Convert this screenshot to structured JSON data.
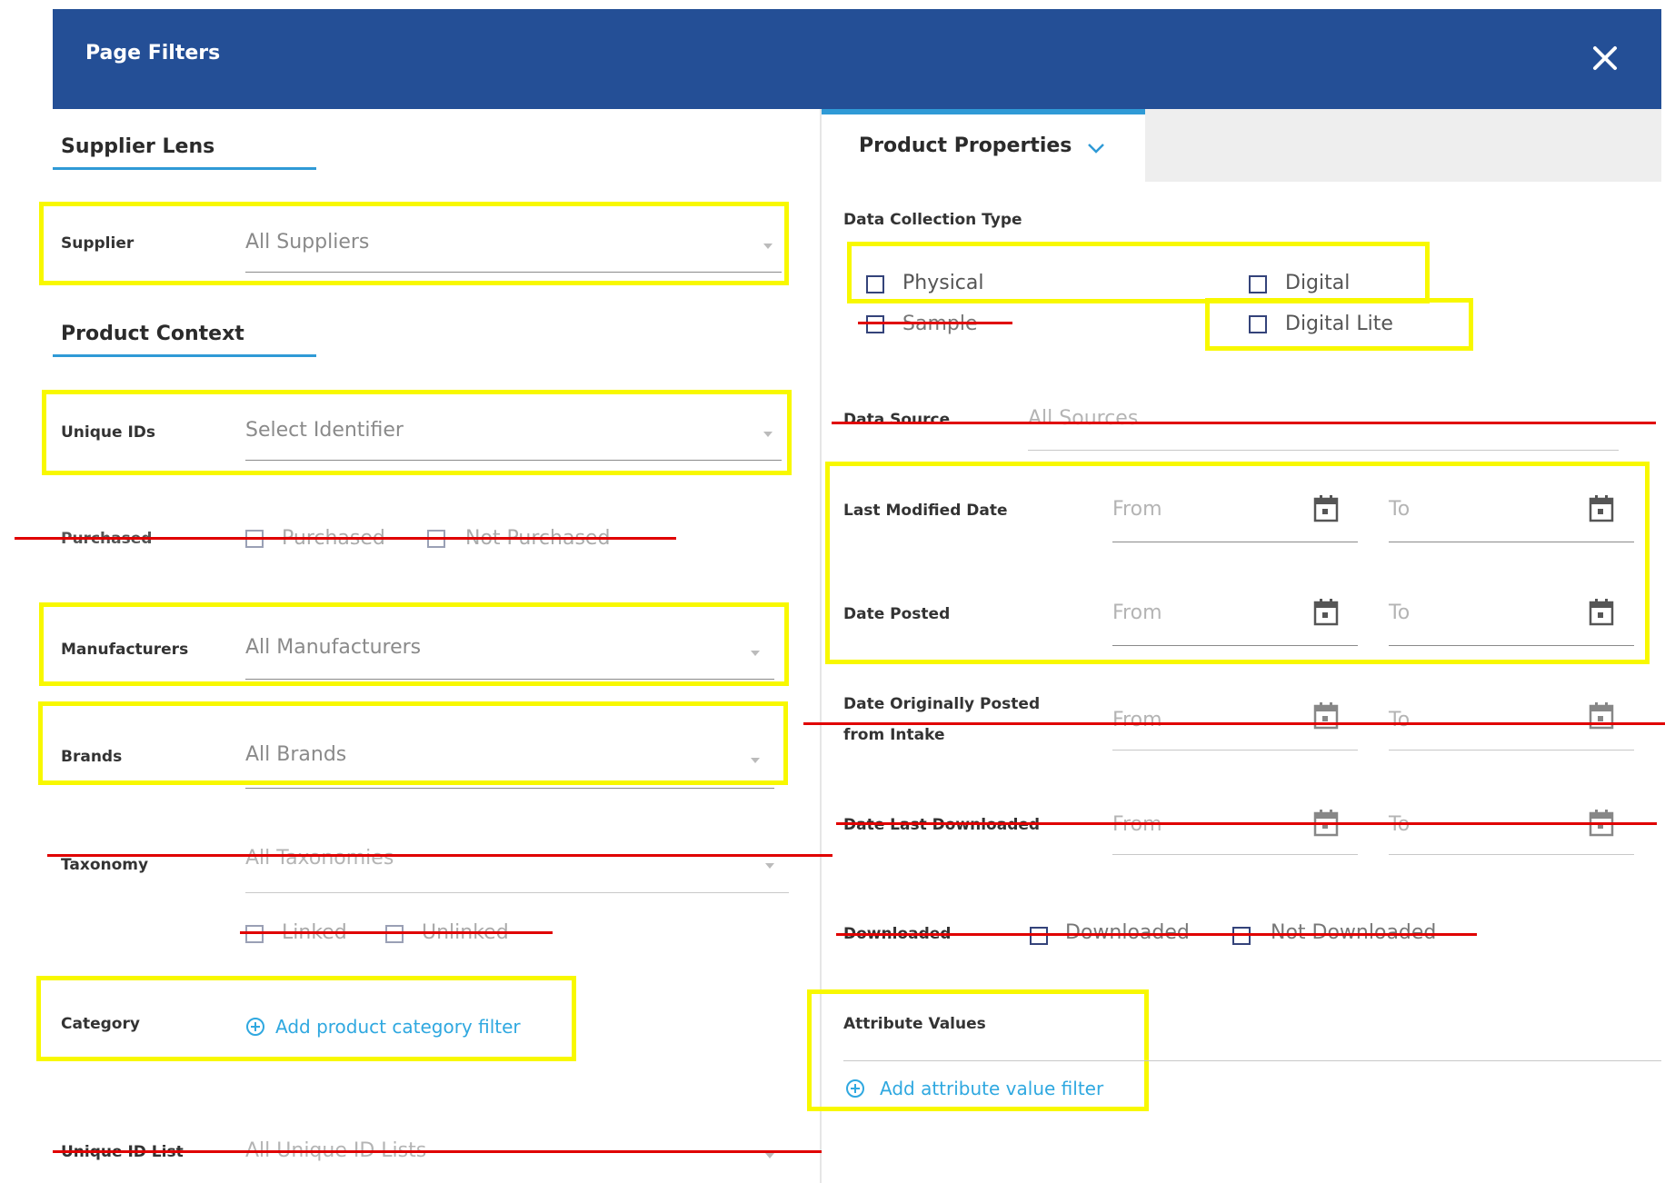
{
  "header": {
    "title": "Page Filters"
  },
  "left": {
    "supplier_lens_title": "Supplier Lens",
    "supplier": {
      "label": "Supplier",
      "value": "All Suppliers"
    },
    "product_context_title": "Product Context",
    "unique_ids": {
      "label": "Unique IDs",
      "value": "Select Identifier"
    },
    "purchased": {
      "label": "Purchased",
      "opt1": "Purchased",
      "opt2": "Not Purchased"
    },
    "manufacturers": {
      "label": "Manufacturers",
      "value": "All Manufacturers"
    },
    "brands": {
      "label": "Brands",
      "value": "All Brands"
    },
    "taxonomy": {
      "label": "Taxonomy",
      "value": "All Taxonomies",
      "opt1": "Linked",
      "opt2": "Unlinked"
    },
    "category": {
      "label": "Category",
      "add_label": "Add product category filter"
    },
    "unique_id_list": {
      "label": "Unique ID List",
      "value": "All Unique ID Lists"
    }
  },
  "right": {
    "tab_label": "Product Properties",
    "data_collection": {
      "label": "Data Collection Type",
      "physical": "Physical",
      "digital": "Digital",
      "sample": "Sample",
      "digital_lite": "Digital Lite"
    },
    "data_source": {
      "label": "Data Source",
      "value": "All Sources"
    },
    "last_modified": {
      "label": "Last Modified Date",
      "from": "From",
      "to": "To"
    },
    "date_posted": {
      "label": "Date Posted",
      "from": "From",
      "to": "To"
    },
    "date_orig": {
      "label_line1": "Date Originally Posted",
      "label_line2": "from Intake",
      "from": "From",
      "to": "To"
    },
    "date_last_dl": {
      "label": "Date Last Downloaded",
      "from": "From",
      "to": "To"
    },
    "downloaded": {
      "label": "Downloaded",
      "opt1": "Downloaded",
      "opt2": "Not Downloaded"
    },
    "attribute_values": {
      "label": "Attribute Values",
      "add_label": "Add attribute value filter"
    }
  },
  "colors": {
    "header_bg": "#244f96",
    "accent": "#2f9ad6",
    "highlight_box": "#f8f800",
    "strike": "#e00000",
    "link": "#2fa8e0"
  },
  "icons": [
    "close-icon",
    "chevron-down-icon",
    "calendar-icon",
    "plus-circle-icon",
    "dropdown-caret-icon"
  ]
}
